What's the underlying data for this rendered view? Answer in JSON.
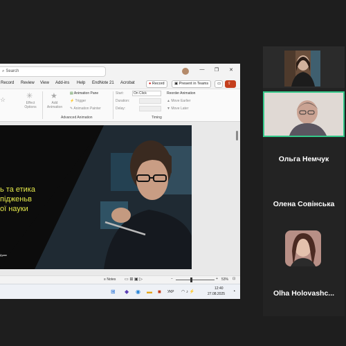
{
  "app": {
    "search_placeholder": "Search",
    "tabs": [
      "Record",
      "Review",
      "View",
      "Add-ins",
      "Help",
      "EndNote 21",
      "Acrobat"
    ],
    "record_button": "Record",
    "present_teams_button": "Present in Teams"
  },
  "ribbon": {
    "effect_options": "Effect Options",
    "add_animation": "Add Animation",
    "animation_pane": "Animation Pane",
    "trigger": "Trigger",
    "animation_painter": "Animation Painter",
    "advanced_group": "Advanced Animation",
    "start_label": "Start:",
    "start_value": "On Click",
    "duration_label": "Duration:",
    "delay_label": "Delay:",
    "timing_group": "Timing",
    "reorder_label": "Reorder Animation",
    "move_earlier": "Move Earlier",
    "move_later": "Move Later"
  },
  "slide": {
    "line1": "ь та етика",
    "line2": "підженьв",
    "line3": "ої науки",
    "small_text": "Дужко"
  },
  "status": {
    "notes": "Notes",
    "zoom": "53%"
  },
  "taskbar": {
    "lang": "УКР",
    "time": "12:40",
    "date": "27.08.2025"
  },
  "participants": [
    {
      "name": ""
    },
    {
      "name": ""
    },
    {
      "name": "Ольга Немчук"
    },
    {
      "name": "Олена Совінська"
    },
    {
      "name": "Olha  Holovashc..."
    }
  ],
  "colors": {
    "active_speaker": "#34c98a",
    "slide_accent": "#e4e84a",
    "panel_bg": "#232323"
  }
}
